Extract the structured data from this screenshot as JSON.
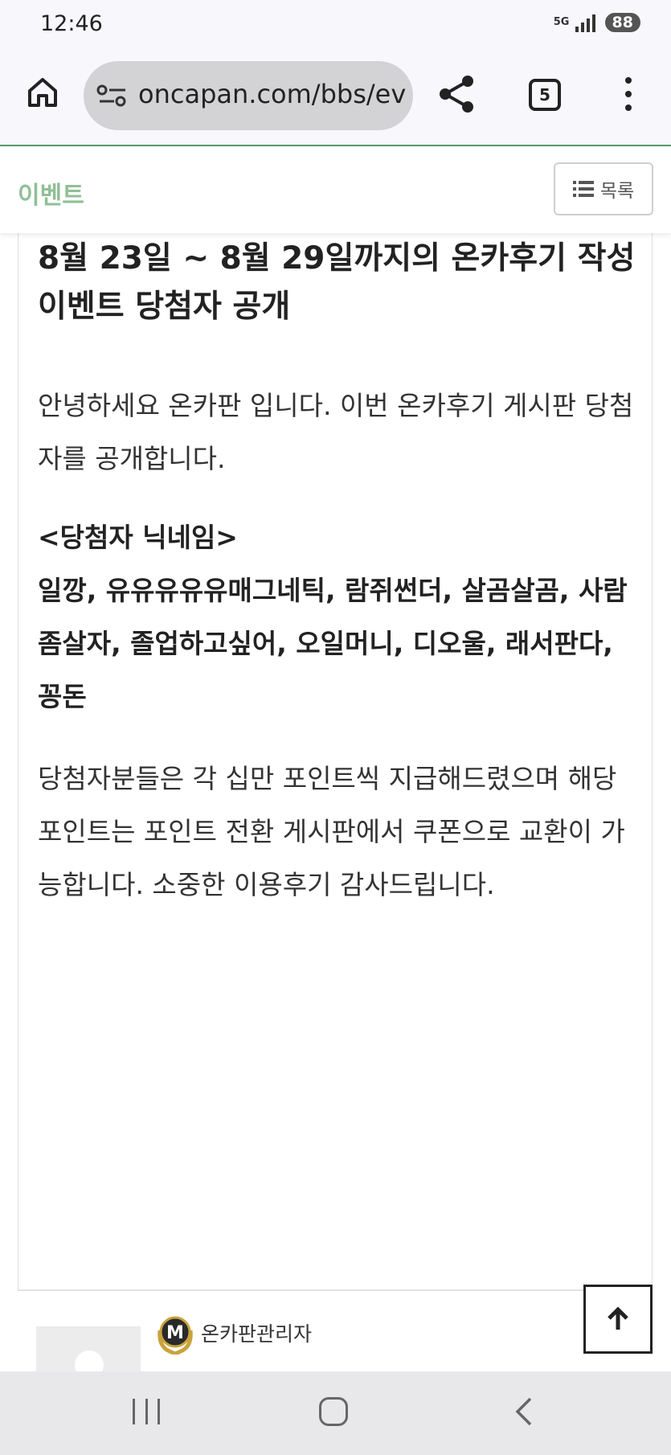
{
  "status_bar": {
    "time": "12:46",
    "network": "5G",
    "battery": "88"
  },
  "browser": {
    "url": "oncapan.com/bbs/ev",
    "tab_count": "5",
    "icons": [
      "home-icon",
      "site-settings-icon",
      "share-icon",
      "tabs-icon",
      "more-menu-icon"
    ]
  },
  "board": {
    "title": "이벤트",
    "list_button_label": "목록"
  },
  "article": {
    "title": "8월 23일 ~ 8월 29일까지의 온카후기 작성 이벤트 당첨자 공개",
    "paragraph_1": "안녕하세요 온카판 입니다. 이번 온카후기 게시판 당첨자를 공개합니다.",
    "winners_heading": "<당첨자 닉네임>",
    "winners_list": "일깡, 유유유유유매그네틱, 람쥐썬더, 살곰살곰, 사람좀살자, 졸업하고싶어, 오일머니, 디오울, 래서판다, 꽁돈",
    "paragraph_3": "당첨자분들은 각 십만 포인트씩 지급해드렸으며 해당 포인트는 포인트 전환 게시판에서 쿠폰으로 교환이 가능합니다. 소중한 이용후기 감사드립니다."
  },
  "author": {
    "badge_letter": "M",
    "name": "온카판관리자"
  },
  "colors": {
    "board_title": "#8fbf96",
    "toolbar_accent": "#4e9a6b"
  }
}
